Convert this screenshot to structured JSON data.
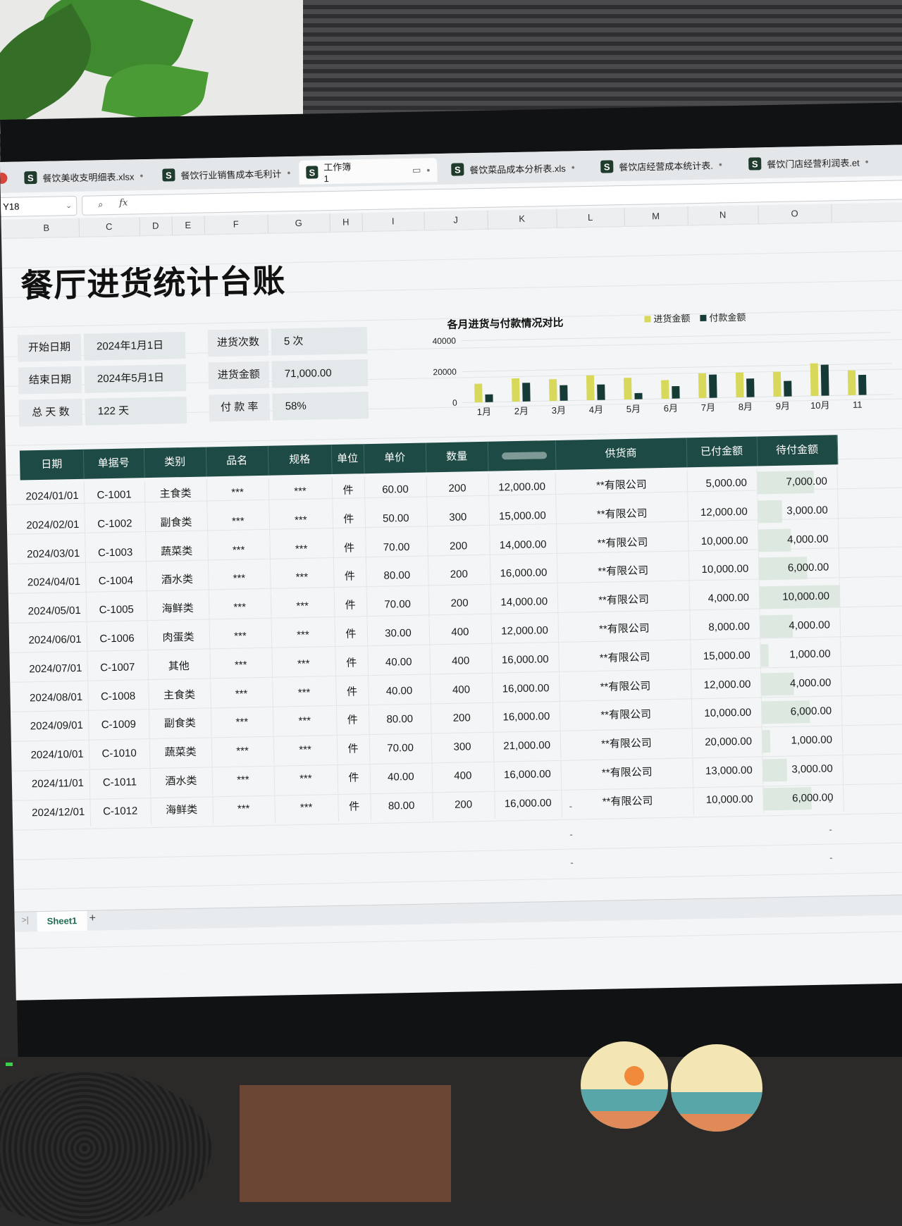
{
  "tabs": [
    {
      "label": "餐饮美收支明细表.xlsx"
    },
    {
      "label": "餐饮行业销售成本毛利计"
    },
    {
      "label": "工作簿1"
    },
    {
      "label": "餐饮菜品成本分析表.xls"
    },
    {
      "label": "餐饮店经营成本统计表."
    },
    {
      "label": "餐饮门店经营利润表.et"
    }
  ],
  "namebox": "Y18",
  "fx_label": "fx",
  "columns": [
    "B",
    "C",
    "D",
    "E",
    "F",
    "G",
    "H",
    "I",
    "J",
    "K",
    "L",
    "M",
    "N",
    "O"
  ],
  "title": "餐厅进货统计台账",
  "info": {
    "start_label": "开始日期",
    "start_value": "2024年1月1日",
    "end_label": "结束日期",
    "end_value": "2024年5月1日",
    "days_label": "总 天 数",
    "days_value": "122 天",
    "count_label": "进货次数",
    "count_value": "5 次",
    "amount_label": "进货金额",
    "amount_value": "71,000.00",
    "rate_label": "付 款 率",
    "rate_value": "58%"
  },
  "chart_data": {
    "type": "bar",
    "title": "各月进货与付款情况对比",
    "categories": [
      "1月",
      "2月",
      "3月",
      "4月",
      "5月",
      "6月",
      "7月",
      "8月",
      "9月",
      "10月",
      "11"
    ],
    "series": [
      {
        "name": "进货金额",
        "color": "#d8d85a",
        "values": [
          12000,
          15000,
          14000,
          16000,
          14000,
          12000,
          16000,
          16000,
          16000,
          21000,
          16000
        ]
      },
      {
        "name": "付款金额",
        "color": "#163a36",
        "values": [
          5000,
          12000,
          10000,
          10000,
          4000,
          8000,
          15000,
          12000,
          10000,
          20000,
          13000
        ]
      }
    ],
    "y_ticks": [
      "0",
      "20000",
      "40000"
    ],
    "ylim": [
      0,
      40000
    ],
    "legend_position": "top-right"
  },
  "table": {
    "headers": [
      "日期",
      "单据号",
      "类别",
      "品名",
      "规格",
      "单位",
      "单价",
      "数量",
      "",
      "供货商",
      "已付金额",
      "待付金额"
    ],
    "rows": [
      [
        "2024/01/01",
        "C-1001",
        "主食类",
        "***",
        "***",
        "件",
        "60.00",
        "200",
        "12,000.00",
        "**有限公司",
        "5,000.00",
        "7,000.00"
      ],
      [
        "2024/02/01",
        "C-1002",
        "副食类",
        "***",
        "***",
        "件",
        "50.00",
        "300",
        "15,000.00",
        "**有限公司",
        "12,000.00",
        "3,000.00"
      ],
      [
        "2024/03/01",
        "C-1003",
        "蔬菜类",
        "***",
        "***",
        "件",
        "70.00",
        "200",
        "14,000.00",
        "**有限公司",
        "10,000.00",
        "4,000.00"
      ],
      [
        "2024/04/01",
        "C-1004",
        "酒水类",
        "***",
        "***",
        "件",
        "80.00",
        "200",
        "16,000.00",
        "**有限公司",
        "10,000.00",
        "6,000.00"
      ],
      [
        "2024/05/01",
        "C-1005",
        "海鲜类",
        "***",
        "***",
        "件",
        "70.00",
        "200",
        "14,000.00",
        "**有限公司",
        "4,000.00",
        "10,000.00"
      ],
      [
        "2024/06/01",
        "C-1006",
        "肉蛋类",
        "***",
        "***",
        "件",
        "30.00",
        "400",
        "12,000.00",
        "**有限公司",
        "8,000.00",
        "4,000.00"
      ],
      [
        "2024/07/01",
        "C-1007",
        "其他",
        "***",
        "***",
        "件",
        "40.00",
        "400",
        "16,000.00",
        "**有限公司",
        "15,000.00",
        "1,000.00"
      ],
      [
        "2024/08/01",
        "C-1008",
        "主食类",
        "***",
        "***",
        "件",
        "40.00",
        "400",
        "16,000.00",
        "**有限公司",
        "12,000.00",
        "4,000.00"
      ],
      [
        "2024/09/01",
        "C-1009",
        "副食类",
        "***",
        "***",
        "件",
        "80.00",
        "200",
        "16,000.00",
        "**有限公司",
        "10,000.00",
        "6,000.00"
      ],
      [
        "2024/10/01",
        "C-1010",
        "蔬菜类",
        "***",
        "***",
        "件",
        "70.00",
        "300",
        "21,000.00",
        "**有限公司",
        "20,000.00",
        "1,000.00"
      ],
      [
        "2024/11/01",
        "C-1011",
        "酒水类",
        "***",
        "***",
        "件",
        "40.00",
        "400",
        "16,000.00",
        "**有限公司",
        "13,000.00",
        "3,000.00"
      ],
      [
        "2024/12/01",
        "C-1012",
        "海鲜类",
        "***",
        "***",
        "件",
        "80.00",
        "200",
        "16,000.00",
        "**有限公司",
        "10,000.00",
        "6,000.00"
      ]
    ],
    "empty_marker": "-"
  },
  "sheet_tab": "Sheet1",
  "add_sheet": "+"
}
